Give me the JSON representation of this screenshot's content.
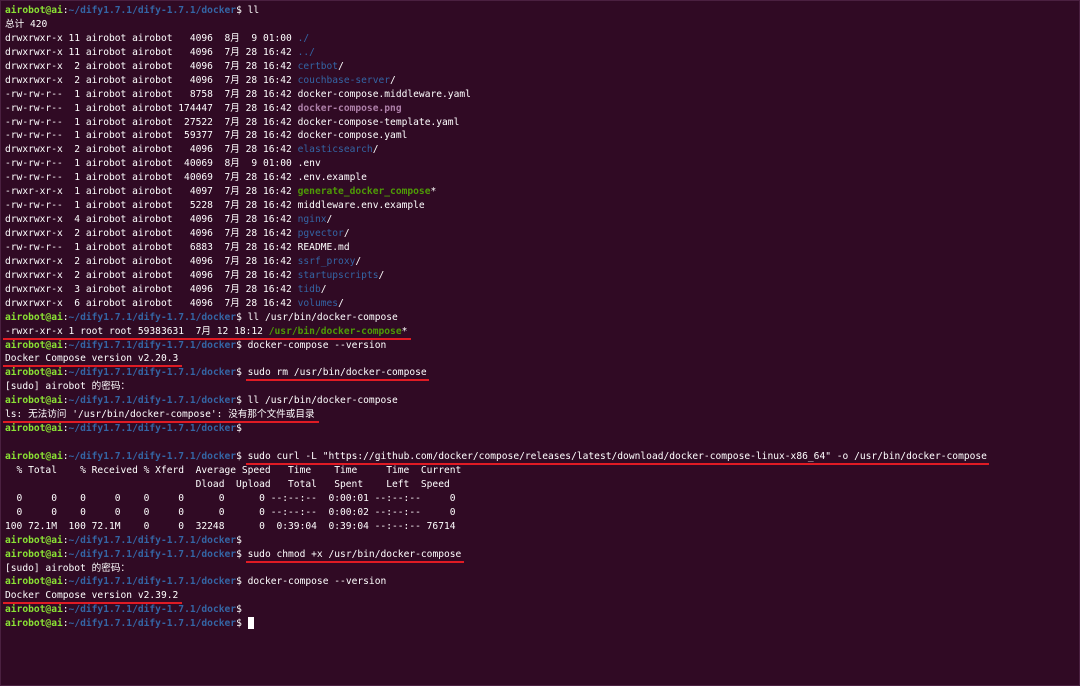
{
  "terminal": {
    "prompt_user": "airobot@ai",
    "lines": [
      {
        "t": "prompt",
        "path": "~/dify1.7.1/dify-1.7.1/docker",
        "cmd": "ll"
      },
      {
        "t": "text",
        "text": "总计 420"
      },
      {
        "t": "ls",
        "meta": "drwxrwxr-x 11 airobot airobot   4096  8月  9 01:00 ",
        "name": "./",
        "cls": "dir"
      },
      {
        "t": "ls",
        "meta": "drwxrwxr-x 11 airobot airobot   4096  7月 28 16:42 ",
        "name": "../",
        "cls": "dir"
      },
      {
        "t": "ls",
        "meta": "drwxrwxr-x  2 airobot airobot   4096  7月 28 16:42 ",
        "name": "certbot",
        "cls": "dir",
        "suffix": "/"
      },
      {
        "t": "ls",
        "meta": "drwxrwxr-x  2 airobot airobot   4096  7月 28 16:42 ",
        "name": "couchbase-server",
        "cls": "dir",
        "suffix": "/"
      },
      {
        "t": "ls",
        "meta": "-rw-rw-r--  1 airobot airobot   8758  7月 28 16:42 ",
        "name": "docker-compose.middleware.yaml",
        "cls": ""
      },
      {
        "t": "ls",
        "meta": "-rw-rw-r--  1 airobot airobot 174447  7月 28 16:42 ",
        "name": "docker-compose.png",
        "cls": "img"
      },
      {
        "t": "ls",
        "meta": "-rw-rw-r--  1 airobot airobot  27522  7月 28 16:42 ",
        "name": "docker-compose-template.yaml",
        "cls": ""
      },
      {
        "t": "ls",
        "meta": "-rw-rw-r--  1 airobot airobot  59377  7月 28 16:42 ",
        "name": "docker-compose.yaml",
        "cls": ""
      },
      {
        "t": "ls",
        "meta": "drwxrwxr-x  2 airobot airobot   4096  7月 28 16:42 ",
        "name": "elasticsearch",
        "cls": "dir",
        "suffix": "/"
      },
      {
        "t": "ls",
        "meta": "-rw-rw-r--  1 airobot airobot  40069  8月  9 01:00 ",
        "name": ".env",
        "cls": ""
      },
      {
        "t": "ls",
        "meta": "-rw-rw-r--  1 airobot airobot  40069  7月 28 16:42 ",
        "name": ".env.example",
        "cls": ""
      },
      {
        "t": "ls",
        "meta": "-rwxr-xr-x  1 airobot airobot   4097  7月 28 16:42 ",
        "name": "generate_docker_compose",
        "cls": "exe",
        "suffix": "*"
      },
      {
        "t": "ls",
        "meta": "-rw-rw-r--  1 airobot airobot   5228  7月 28 16:42 ",
        "name": "middleware.env.example",
        "cls": ""
      },
      {
        "t": "ls",
        "meta": "drwxrwxr-x  4 airobot airobot   4096  7月 28 16:42 ",
        "name": "nginx",
        "cls": "dir",
        "suffix": "/"
      },
      {
        "t": "ls",
        "meta": "drwxrwxr-x  2 airobot airobot   4096  7月 28 16:42 ",
        "name": "pgvector",
        "cls": "dir",
        "suffix": "/"
      },
      {
        "t": "ls",
        "meta": "-rw-rw-r--  1 airobot airobot   6883  7月 28 16:42 ",
        "name": "README.md",
        "cls": ""
      },
      {
        "t": "ls",
        "meta": "drwxrwxr-x  2 airobot airobot   4096  7月 28 16:42 ",
        "name": "ssrf_proxy",
        "cls": "dir",
        "suffix": "/"
      },
      {
        "t": "ls",
        "meta": "drwxrwxr-x  2 airobot airobot   4096  7月 28 16:42 ",
        "name": "startupscripts",
        "cls": "dir",
        "suffix": "/"
      },
      {
        "t": "ls",
        "meta": "drwxrwxr-x  3 airobot airobot   4096  7月 28 16:42 ",
        "name": "tidb",
        "cls": "dir",
        "suffix": "/"
      },
      {
        "t": "ls",
        "meta": "drwxrwxr-x  6 airobot airobot   4096  7月 28 16:42 ",
        "name": "volumes",
        "cls": "dir",
        "suffix": "/"
      },
      {
        "t": "prompt",
        "path": "~/dify1.7.1/dify-1.7.1/docker",
        "cmd": "ll /usr/bin/docker-compose"
      },
      {
        "t": "ls",
        "meta": "-rwxr-xr-x 1 root root 59383631  7月 12 18:12 ",
        "name": "/usr/bin/docker-compose",
        "cls": "exe",
        "suffix": "*",
        "ul": true
      },
      {
        "t": "prompt",
        "path": "~/dify1.7.1/dify-1.7.1/docker",
        "cmd": "docker-compose --version"
      },
      {
        "t": "text",
        "text": "Docker Compose version v2.20.3",
        "ul": true
      },
      {
        "t": "prompt",
        "path": "~/dify1.7.1/dify-1.7.1/docker",
        "cmd": "sudo rm /usr/bin/docker-compose",
        "ulcmd": true
      },
      {
        "t": "text",
        "text": "[sudo] airobot 的密码："
      },
      {
        "t": "prompt",
        "path": "~/dify1.7.1/dify-1.7.1/docker",
        "cmd": "ll /usr/bin/docker-compose"
      },
      {
        "t": "text",
        "text": "ls: 无法访问 '/usr/bin/docker-compose': 没有那个文件或目录",
        "ul": true
      },
      {
        "t": "prompt",
        "path": "~/dify1.7.1/dify-1.7.1/docker",
        "cmd": ""
      },
      {
        "t": "text",
        "text": ""
      },
      {
        "t": "prompt",
        "path": "~/dify1.7.1/dify-1.7.1/docker",
        "cmd": "sudo curl -L \"https://github.com/docker/compose/releases/latest/download/docker-compose-linux-x86_64\" -o /usr/bin/docker-compose",
        "ulcmd": true
      },
      {
        "t": "text",
        "text": "  % Total    % Received % Xferd  Average Speed   Time    Time     Time  Current"
      },
      {
        "t": "text",
        "text": "                                 Dload  Upload   Total   Spent    Left  Speed"
      },
      {
        "t": "text",
        "text": "  0     0    0     0    0     0      0      0 --:--:--  0:00:01 --:--:--     0"
      },
      {
        "t": "text",
        "text": "  0     0    0     0    0     0      0      0 --:--:--  0:00:02 --:--:--     0"
      },
      {
        "t": "text",
        "text": "100 72.1M  100 72.1M    0     0  32248      0  0:39:04  0:39:04 --:--:-- 76714"
      },
      {
        "t": "prompt",
        "path": "~/dify1.7.1/dify-1.7.1/docker",
        "cmd": ""
      },
      {
        "t": "prompt",
        "path": "~/dify1.7.1/dify-1.7.1/docker",
        "cmd": "sudo chmod +x /usr/bin/docker-compose",
        "ulcmd": true
      },
      {
        "t": "text",
        "text": "[sudo] airobot 的密码："
      },
      {
        "t": "prompt",
        "path": "~/dify1.7.1/dify-1.7.1/docker",
        "cmd": "docker-compose --version"
      },
      {
        "t": "text",
        "text": "Docker Compose version v2.39.2",
        "ul": true
      },
      {
        "t": "prompt",
        "path": "~/dify1.7.1/dify-1.7.1/docker",
        "cmd": ""
      },
      {
        "t": "prompt",
        "path": "~/dify1.7.1/dify-1.7.1/docker",
        "cmd": "",
        "cursor": true
      }
    ]
  }
}
